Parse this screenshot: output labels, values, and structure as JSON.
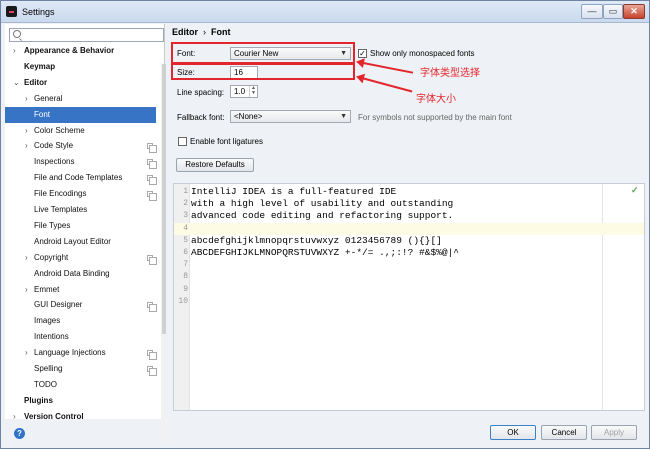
{
  "window": {
    "title": "Settings",
    "minimize": "—",
    "maximize": "▭",
    "close": "✕"
  },
  "search": {
    "value": ""
  },
  "sidebar": {
    "items": [
      {
        "label": "Appearance & Behavior",
        "arrow": "›",
        "bold": true
      },
      {
        "label": "Keymap",
        "arrow": "",
        "bold": true
      },
      {
        "label": "Editor",
        "arrow": "⌄",
        "bold": true
      },
      {
        "label": "General",
        "arrow": "›"
      },
      {
        "label": "Font",
        "arrow": "",
        "selected": true
      },
      {
        "label": "Color Scheme",
        "arrow": "›"
      },
      {
        "label": "Code Style",
        "arrow": "›",
        "copy": true
      },
      {
        "label": "Inspections",
        "arrow": "",
        "copy": true
      },
      {
        "label": "File and Code Templates",
        "arrow": "",
        "copy": true
      },
      {
        "label": "File Encodings",
        "arrow": "",
        "copy": true
      },
      {
        "label": "Live Templates",
        "arrow": ""
      },
      {
        "label": "File Types",
        "arrow": ""
      },
      {
        "label": "Android Layout Editor",
        "arrow": ""
      },
      {
        "label": "Copyright",
        "arrow": "›",
        "copy": true
      },
      {
        "label": "Android Data Binding",
        "arrow": ""
      },
      {
        "label": "Emmet",
        "arrow": "›"
      },
      {
        "label": "GUI Designer",
        "arrow": "",
        "copy": true
      },
      {
        "label": "Images",
        "arrow": ""
      },
      {
        "label": "Intentions",
        "arrow": ""
      },
      {
        "label": "Language Injections",
        "arrow": "›",
        "copy": true
      },
      {
        "label": "Spelling",
        "arrow": "",
        "copy": true
      },
      {
        "label": "TODO",
        "arrow": ""
      },
      {
        "label": "Plugins",
        "arrow": "",
        "bold": true
      },
      {
        "label": "Version Control",
        "arrow": "›",
        "bold": true
      }
    ]
  },
  "breadcrumb": {
    "part1": "Editor",
    "sep": "›",
    "part2": "Font"
  },
  "font": {
    "font_label": "Font:",
    "font_value": "Courier New",
    "mono_label": "Show only monospaced fonts",
    "mono_checked": "✓",
    "size_label": "Size:",
    "size_value": "16",
    "spacing_label": "Line spacing:",
    "spacing_value": "1.0",
    "fallback_label": "Fallback font:",
    "fallback_value": "<None>",
    "fallback_hint": "For symbols not supported by the main font",
    "ligatures_label": "Enable font ligatures",
    "restore_label": "Restore Defaults"
  },
  "annotations": {
    "font_type": "字体类型选择",
    "font_size": "字体大小"
  },
  "preview": {
    "lines": [
      "IntelliJ IDEA is a full-featured IDE",
      "with a high level of usability and outstanding",
      "advanced code editing and refactoring support.",
      "",
      "abcdefghijklmnopqrstuvwxyz 0123456789 (){}[]",
      "ABCDEFGHIJKLMNOPQRSTUVWXYZ +-*/= .,;:!? #&$%@|^",
      "",
      "",
      "",
      ""
    ],
    "numbers": [
      "1",
      "2",
      "3",
      "4",
      "5",
      "6",
      "7",
      "8",
      "9",
      "10"
    ],
    "check": "✓"
  },
  "footer": {
    "help": "?",
    "ok": "OK",
    "cancel": "Cancel",
    "apply": "Apply"
  },
  "colors": {
    "selection": "#3874c6",
    "annotation": "#e3262c"
  }
}
